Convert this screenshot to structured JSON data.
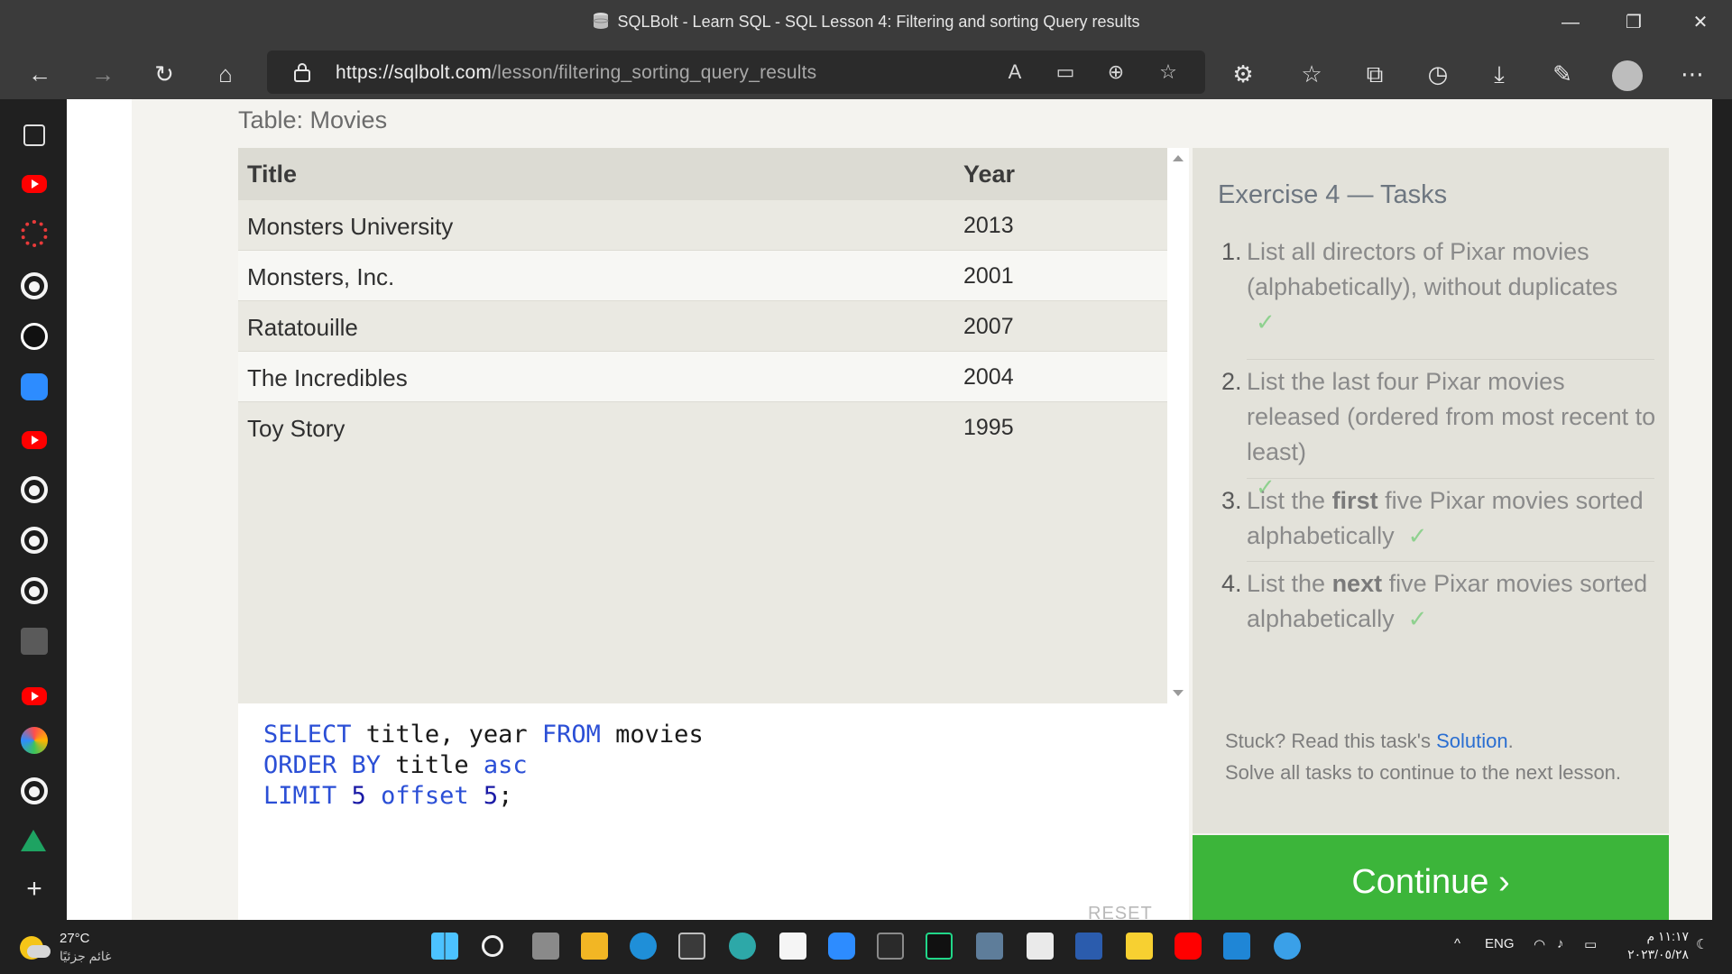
{
  "window": {
    "title": "SQLBolt - Learn SQL - SQL Lesson 4: Filtering and sorting Query results",
    "minimize": "—",
    "maximize": "❐",
    "close": "✕"
  },
  "toolbar": {
    "url_host": "https://sqlbolt.com",
    "url_path": "/lesson/filtering_sorting_query_results"
  },
  "page": {
    "table_label": "Table: Movies",
    "columns": [
      "Title",
      "Year"
    ],
    "rows": [
      {
        "title": "Monsters University",
        "year": "2013"
      },
      {
        "title": "Monsters, Inc.",
        "year": "2001"
      },
      {
        "title": "Ratatouille",
        "year": "2007"
      },
      {
        "title": "The Incredibles",
        "year": "2004"
      },
      {
        "title": "Toy Story",
        "year": "1995"
      }
    ],
    "query": {
      "l1_kw1": "SELECT",
      "l1_txt": " title, year ",
      "l1_kw2": "FROM",
      "l1_txt2": " movies",
      "l2_kw1": "ORDER BY",
      "l2_txt": " title ",
      "l2_kw2": "asc",
      "l3_kw1": "LIMIT",
      "l3_num1": " 5 ",
      "l3_kw2": "offset",
      "l3_num2": " 5",
      "l3_end": ";"
    },
    "reset_label": "RESET",
    "exercise": {
      "heading": "Exercise 4 — Tasks",
      "tasks": [
        {
          "num": "1.",
          "before": "List all directors of Pixar movies (alphabetically), without duplicates",
          "bold": "",
          "after": "",
          "check": "✓"
        },
        {
          "num": "2.",
          "before": "List the last four Pixar movies released (ordered from most recent to least)",
          "bold": "",
          "after": "",
          "check": "✓"
        },
        {
          "num": "3.",
          "before": "List the ",
          "bold": "first",
          "after": " five Pixar movies sorted alphabetically",
          "check": "✓"
        },
        {
          "num": "4.",
          "before": "List the ",
          "bold": "next",
          "after": " five Pixar movies sorted alphabetically",
          "check": "✓"
        }
      ],
      "stuck_prefix": "Stuck? Read this task's ",
      "solution_link": "Solution",
      "stuck_suffix": ".",
      "solve_text": "Solve all tasks to continue to the next lesson."
    },
    "continue_label": "Continue ›"
  },
  "taskbar": {
    "temperature": "27°C",
    "condition": "غائم جزئيًا",
    "language": "ENG",
    "time": "١١:١٧ م",
    "date": "٢٠٢٣/٠٥/٢٨"
  },
  "colors": {
    "keyword": "#2b4fd6",
    "continue_bg": "#3cb53a",
    "link": "#2a6ed1",
    "check": "#8fd18f"
  }
}
